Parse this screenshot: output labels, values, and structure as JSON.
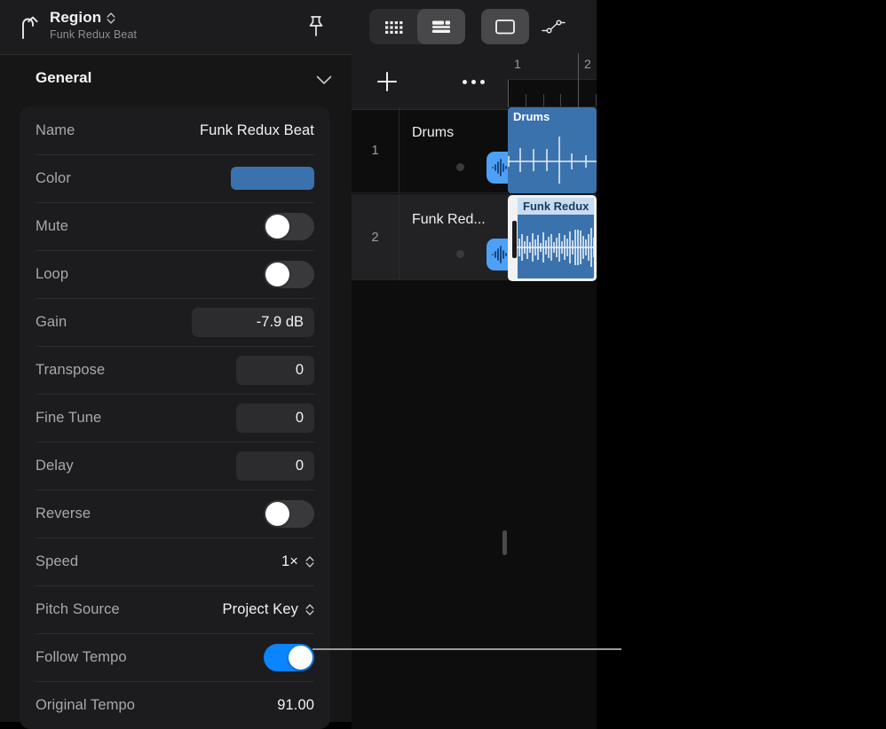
{
  "inspector": {
    "back_icon": "back-arrow-icon",
    "title": "Region",
    "subtitle": "Funk Redux Beat",
    "pin_icon": "pin-icon",
    "section": {
      "title": "General",
      "collapse_icon": "chevron-down-icon"
    },
    "rows": [
      {
        "label": "Name",
        "type": "text",
        "value": "Funk Redux Beat"
      },
      {
        "label": "Color",
        "type": "color",
        "value": "#3a72ad"
      },
      {
        "label": "Mute",
        "type": "toggle",
        "value": "off"
      },
      {
        "label": "Loop",
        "type": "toggle",
        "value": "off"
      },
      {
        "label": "Gain",
        "type": "field",
        "value": "-7.9 dB"
      },
      {
        "label": "Transpose",
        "type": "field",
        "value": "0"
      },
      {
        "label": "Fine Tune",
        "type": "field",
        "value": "0"
      },
      {
        "label": "Delay",
        "type": "field",
        "value": "0"
      },
      {
        "label": "Reverse",
        "type": "toggle",
        "value": "off"
      },
      {
        "label": "Speed",
        "type": "stepper",
        "value": "1×"
      },
      {
        "label": "Pitch Source",
        "type": "stepper",
        "value": "Project Key"
      },
      {
        "label": "Follow Tempo",
        "type": "toggle",
        "value": "on"
      },
      {
        "label": "Original Tempo",
        "type": "text",
        "value": "91.00"
      }
    ]
  },
  "tracks_window": {
    "toolbar": {
      "buttons": [
        {
          "name": "browser-grid-icon",
          "active": false
        },
        {
          "name": "track-list-icon",
          "active": true
        },
        {
          "name": "region-view-icon",
          "active": true
        },
        {
          "name": "automation-node-icon",
          "active": false
        }
      ]
    },
    "track_header": {
      "add_label": "+",
      "add_icon": "plus-icon",
      "more_icon": "more-ellipsis-icon"
    },
    "ruler": {
      "bars": [
        "1",
        "2"
      ]
    },
    "tracks": [
      {
        "number": "1",
        "name": "Drums",
        "icon": "audio-waveform-icon",
        "selected": false
      },
      {
        "number": "2",
        "name": "Funk Red...",
        "icon": "audio-waveform-icon",
        "selected": true
      }
    ],
    "regions": [
      {
        "title": "Drums",
        "track": 1,
        "selected": false
      },
      {
        "title": "Funk Redux",
        "track": 2,
        "selected": true
      }
    ]
  },
  "colors": {
    "accent_blue": "#0a84ff",
    "region_blue": "#3a72ad",
    "track_icon_blue": "#4ea0f7",
    "panel_bg": "#1c1c1e",
    "callout_line": "#9a9a9a"
  }
}
